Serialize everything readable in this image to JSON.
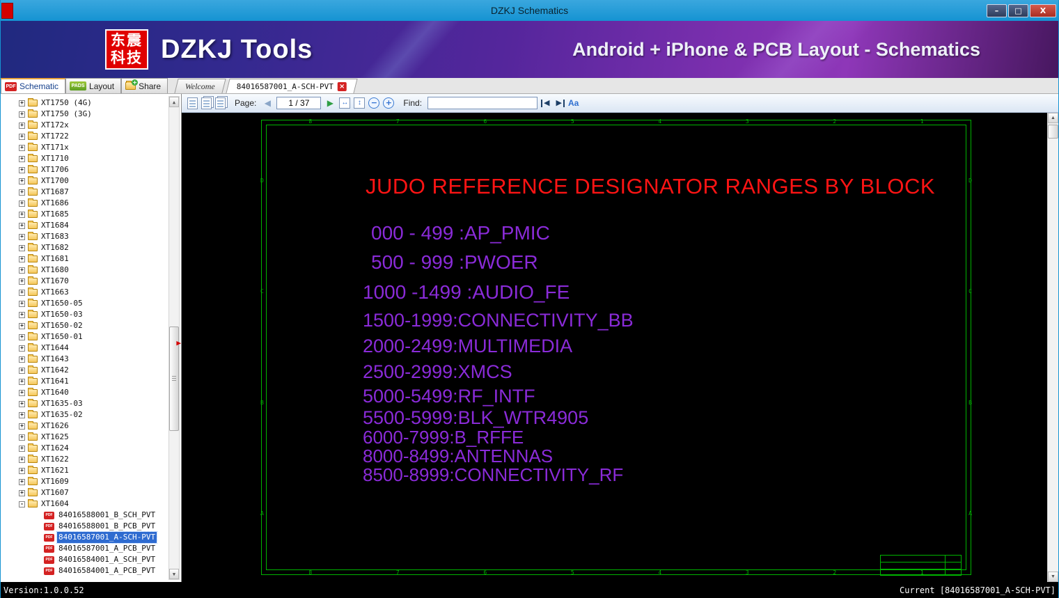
{
  "window": {
    "title": "DZKJ Schematics",
    "minimize": "–",
    "maximize": "□",
    "close": "X"
  },
  "banner": {
    "logo_top": "东震",
    "logo_bottom": "科技",
    "app_name": "DZKJ Tools",
    "tagline": "Android + iPhone & PCB Layout - Schematics"
  },
  "icons": {
    "pdf_badge": "PDF",
    "pads_badge": "PADS"
  },
  "tabs": {
    "schematic": "Schematic",
    "layout": "Layout",
    "share": "Share",
    "welcome": "Welcome",
    "document": "84016587001_A-SCH-PVT"
  },
  "toolbar": {
    "page_label": "Page:",
    "page_value": "1 / 37",
    "find_label": "Find:",
    "find_value": ""
  },
  "sidebar": {
    "folders": [
      "XT1750 (4G)",
      "XT1750 (3G)",
      "XT172x",
      "XT1722",
      "XT171x",
      "XT1710",
      "XT1706",
      "XT1700",
      "XT1687",
      "XT1686",
      "XT1685",
      "XT1684",
      "XT1683",
      "XT1682",
      "XT1681",
      "XT1680",
      "XT1670",
      "XT1663",
      "XT1650-05",
      "XT1650-03",
      "XT1650-02",
      "XT1650-01",
      "XT1644",
      "XT1643",
      "XT1642",
      "XT1641",
      "XT1640",
      "XT1635-03",
      "XT1635-02",
      "XT1626",
      "XT1625",
      "XT1624",
      "XT1622",
      "XT1621",
      "XT1609",
      "XT1607",
      "XT1604"
    ],
    "files": [
      {
        "label": "84016588001_B_SCH_PVT",
        "selected": false
      },
      {
        "label": "84016588001_B_PCB_PVT",
        "selected": false
      },
      {
        "label": "84016587001_A-SCH-PVT",
        "selected": true
      },
      {
        "label": "84016587001_A_PCB_PVT",
        "selected": false
      },
      {
        "label": "84016584001_A_SCH_PVT",
        "selected": false
      },
      {
        "label": "84016584001_A_PCB_PVT",
        "selected": false
      }
    ]
  },
  "schematic": {
    "title": "JUDO REFERENCE DESIGNATOR RANGES BY BLOCK",
    "ranges": [
      "000 - 499 :AP_PMIC",
      "500 - 999 :PWOER",
      "1000 -1499 :AUDIO_FE",
      "1500-1999:CONNECTIVITY_BB",
      "2000-2499:MULTIMEDIA",
      "2500-2999:XMCS",
      "5000-5499:RF_INTF",
      "5500-5999:BLK_WTR4905",
      "6000-7999:B_RFFE",
      "8000-8499:ANTENNAS",
      "8500-8999:CONNECTIVITY_RF"
    ],
    "frame_cols": [
      "8",
      "7",
      "6",
      "5",
      "4",
      "3",
      "2",
      "1"
    ],
    "frame_rows": [
      "D",
      "C",
      "B",
      "A"
    ],
    "colors": {
      "title": "#ff1414",
      "ranges": "#8a2bd8",
      "frame": "#00b400"
    }
  },
  "statusbar": {
    "version": "Version:1.0.0.52",
    "current": "Current [84016587001_A-SCH-PVT]"
  }
}
